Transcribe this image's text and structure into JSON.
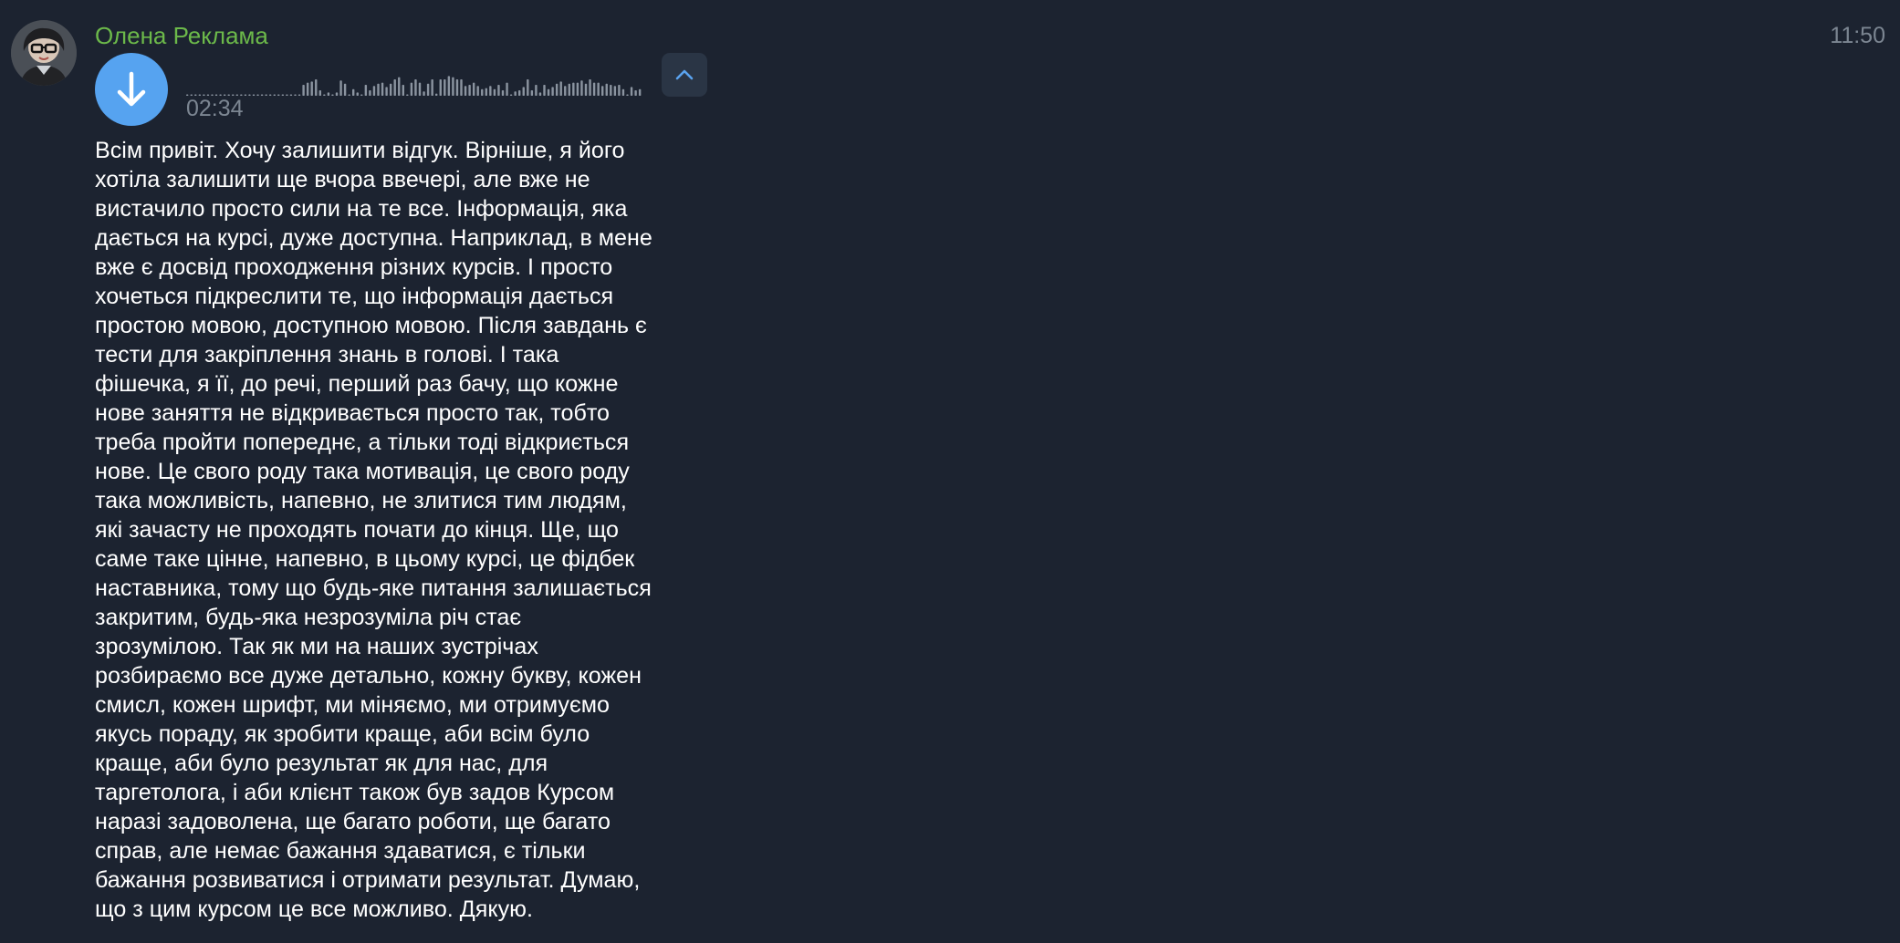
{
  "message": {
    "sender": "Олена Реклама",
    "time": "11:50",
    "avatar_icon": "user-avatar-photo",
    "sender_color": "#6cb94a"
  },
  "voice_message": {
    "duration": "02:34",
    "download_icon": "arrow-down-icon",
    "transcribe_icon": "chevron-up-icon",
    "accent_color": "#56a3f0",
    "waveform_levels": [
      0,
      0,
      0,
      0,
      0,
      0,
      0,
      0,
      0,
      0,
      0,
      0,
      0,
      0,
      0,
      0,
      0,
      0,
      0,
      0,
      0,
      0,
      0,
      0,
      0,
      0,
      0,
      0,
      0.5,
      0.6,
      0.65,
      0.75,
      0.25,
      0,
      0.15,
      0,
      0.15,
      0.7,
      0.55,
      0,
      0.3,
      0.15,
      0,
      0.5,
      0.25,
      0.45,
      0.55,
      0.6,
      0.4,
      0.55,
      0.75,
      0.85,
      0.5,
      0,
      0.6,
      0.75,
      0.6,
      0.2,
      0.55,
      0.75,
      0.1,
      0.75,
      0.75,
      0.9,
      0.85,
      0.75,
      0.75,
      0.45,
      0.5,
      0.6,
      0.45,
      0.3,
      0.35,
      0.45,
      0.3,
      0.5,
      0.25,
      0.6,
      0,
      0.2,
      0.25,
      0.4,
      0.75,
      0.25,
      0.5,
      0.15,
      0.5,
      0.3,
      0.4,
      0.55,
      0.65,
      0.45,
      0.55,
      0.6,
      0.6,
      0.7,
      0.55,
      0.75,
      0.6,
      0.6,
      0.45,
      0.55,
      0.5,
      0.45,
      0.5,
      0.3,
      0,
      0.4,
      0.25,
      0.3
    ]
  },
  "transcript": {
    "lines": [
      "Всім привіт. Хочу залишити відгук. Вірніше, я його",
      "хотіла залишити ще вчора ввечері, але вже не",
      "вистачило просто сили на те все. Інформація, яка",
      "дається на курсі, дуже доступна. Наприклад, в мене",
      "вже є досвід проходження різних курсів. І просто",
      "хочеться підкреслити те, що інформація дається",
      "простою мовою, доступною мовою. Після завдань є",
      "тести для закріплення знань в голові. І така",
      "фішечка, я її, до речі, перший раз бачу, що кожне",
      "нове заняття не відкривається просто так, тобто",
      "треба пройти попереднє, а тільки тоді відкриється",
      "нове. Це свого роду така мотивація, це свого роду",
      "така можливість, напевно, не злитися тим людям,",
      "які зачасту не проходять почати до кінця. Ще, що",
      "саме таке цінне, напевно, в цьому курсі, це фідбек",
      "наставника, тому що будь-яке питання залишається",
      "закритим, будь-яка незрозуміла річ стає",
      "зрозумілою. Так як ми на наших зустрічах",
      "розбираємо все дуже детально, кожну букву, кожен",
      "смисл, кожен шрифт, ми міняємо, ми отримуємо",
      "якусь пораду, як зробити краще, аби всім було",
      "краще, аби було результат як для нас, для",
      "таргетолога, і аби клієнт також був задов Курсом",
      "наразі задоволена, ще багато роботи, ще багато",
      "справ, але немає бажання здаватися, є тільки",
      "бажання розвиватися і отримати результат. Думаю,",
      "що з цим курсом це все можливо. Дякую."
    ]
  }
}
